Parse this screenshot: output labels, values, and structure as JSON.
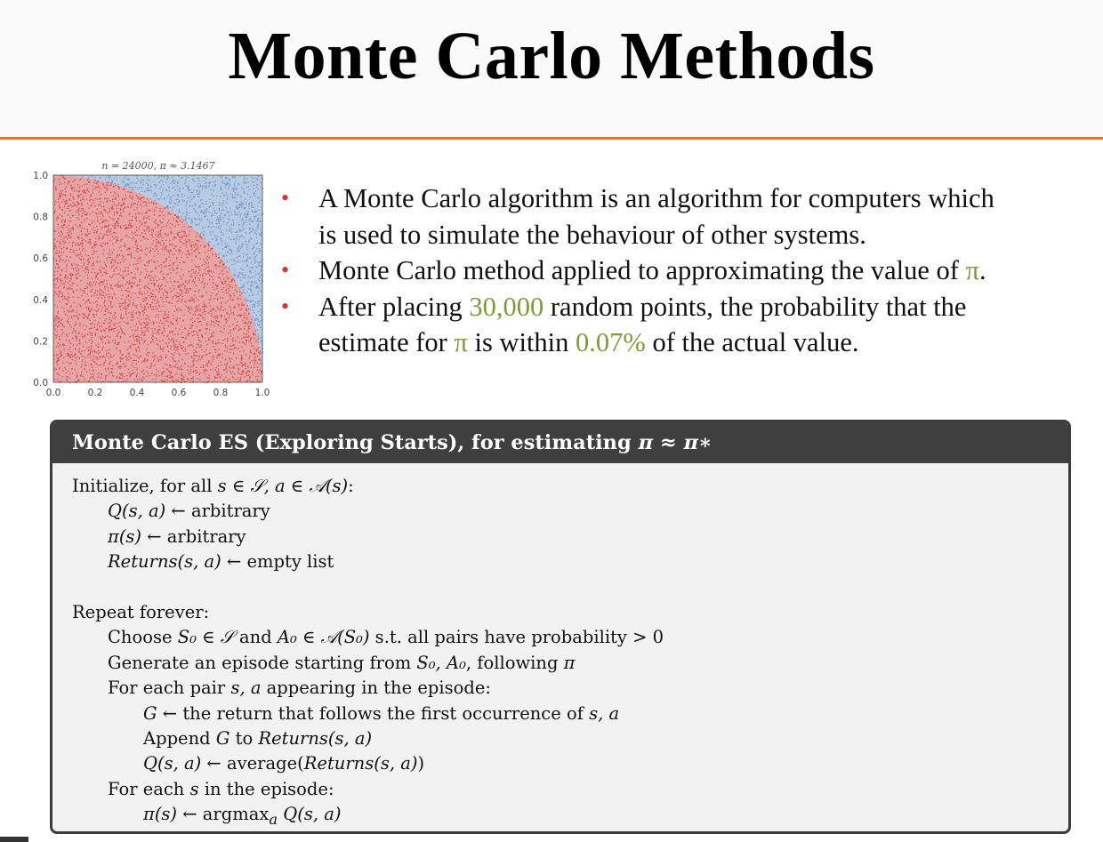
{
  "slide": {
    "title": "Monte Carlo Methods",
    "accent_color": "#d9793f",
    "bullet_color": "#d03a32",
    "highlight_color": "#7e9a3e"
  },
  "plot": {
    "title": "n = 24000, π ≈ 3.1467",
    "x_ticks": [
      "0.0",
      "0.2",
      "0.4",
      "0.6",
      "0.8",
      "1.0"
    ],
    "y_ticks": [
      "0.0",
      "0.2",
      "0.4",
      "0.6",
      "0.8",
      "1.0"
    ],
    "inside_color": "#d0474a",
    "outside_color": "#6e93c4"
  },
  "chart_data": {
    "type": "scatter",
    "title": "n = 24000, π ≈ 3.1467",
    "n_points": 24000,
    "pi_estimate": 3.1467,
    "xlim": [
      0,
      1
    ],
    "ylim": [
      0,
      1
    ],
    "x_ticks": [
      0.0,
      0.2,
      0.4,
      0.6,
      0.8,
      1.0
    ],
    "y_ticks": [
      0.0,
      0.2,
      0.4,
      0.6,
      0.8,
      1.0
    ],
    "series": [
      {
        "name": "",
        "color": "#d0474a",
        "region": "x^2 + y^2 <= 1"
      },
      {
        "name": "",
        "color": "#6e93c4",
        "region": "x^2 + y^2 > 1"
      }
    ],
    "grid": false,
    "legend": "none"
  },
  "bullets": [
    {
      "line1": "A Monte Carlo algorithm is an algorithm for computers which",
      "line2": "is used to simulate the behaviour of other systems."
    },
    {
      "pre": "Monte Carlo method applied to approximating the value of ",
      "pi": "π",
      "post": "."
    },
    {
      "l1_pre": "After placing ",
      "points": "30,000",
      "l1_post": " random points, the probability that the",
      "l2_pre": "estimate for ",
      "pi": "π",
      "l2_mid": " is within ",
      "percent": "0.07%",
      "l2_post": " of the actual value."
    }
  ],
  "algorithm": {
    "header_pre": "Monte Carlo ES (Exploring Starts), for estimating ",
    "header_math": "π ≈ π∗",
    "init": {
      "pre": "Initialize, for all ",
      "m1": "s ∈ 𝒮, a ∈ 𝒜(s)",
      "post": ":"
    },
    "q_init": {
      "m": "Q(s, a)",
      "rest": " ← arbitrary"
    },
    "pi_init": {
      "m": "π(s)",
      "rest": " ← arbitrary"
    },
    "returns_init": {
      "m": "Returns(s, a)",
      "rest": " ← empty list"
    },
    "repeat": "Repeat forever:",
    "choose": {
      "pre": "Choose ",
      "m1": "S₀ ∈ 𝒮",
      "mid": " and ",
      "m2": "A₀ ∈ 𝒜(S₀)",
      "post": " s.t. all pairs have probability > 0"
    },
    "generate": {
      "pre": "Generate an episode starting from ",
      "m1": "S₀, A₀",
      "mid": ", following ",
      "m2": "π"
    },
    "foreach_pair": {
      "pre": "For each pair ",
      "m1": "s, a",
      "post": " appearing in the episode:"
    },
    "g_line": {
      "m1": "G",
      "mid": " ← the return that follows the first occurrence of ",
      "m2": "s, a"
    },
    "append_line": {
      "pre": "Append ",
      "m1": "G",
      "mid": " to ",
      "m2": "Returns(s, a)"
    },
    "q_update": {
      "m1": "Q(s, a)",
      "mid": " ← average(",
      "m2": "Returns(s, a)",
      "post": ")"
    },
    "foreach_s": {
      "pre": "For each ",
      "m1": "s",
      "post": " in the episode:"
    },
    "pi_update": {
      "m1": "π(s)",
      "mid": " ← argmax",
      "sub": "a",
      "m2": " Q(s, a)"
    }
  }
}
